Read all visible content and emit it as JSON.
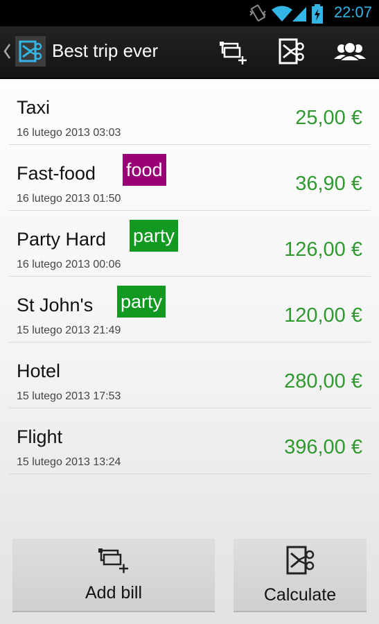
{
  "status_bar": {
    "time": "22:07"
  },
  "action_bar": {
    "title": "Best trip ever",
    "actions": [
      "add-bill-icon",
      "calculate-icon",
      "people-icon"
    ]
  },
  "bills": [
    {
      "name": "Taxi",
      "date": "16 lutego 2013 03:03",
      "amount": "25,00 €",
      "tag": null
    },
    {
      "name": "Fast-food",
      "date": "16 lutego 2013 01:50",
      "amount": "36,90 €",
      "tag": {
        "label": "food",
        "color": "#990077"
      }
    },
    {
      "name": "Party Hard",
      "date": "16 lutego 2013 00:06",
      "amount": "126,00 €",
      "tag": {
        "label": "party",
        "color": "#119922"
      }
    },
    {
      "name": "St John's",
      "date": "15 lutego 2013 21:49",
      "amount": "120,00 €",
      "tag": {
        "label": "party",
        "color": "#119922"
      }
    },
    {
      "name": "Hotel",
      "date": "15 lutego 2013 17:53",
      "amount": "280,00 €",
      "tag": null
    },
    {
      "name": "Flight",
      "date": "15 lutego 2013 13:24",
      "amount": "396,00 €",
      "tag": null
    }
  ],
  "buttons": {
    "add_bill": "Add bill",
    "calculate": "Calculate"
  },
  "colors": {
    "amount": "#2e9a2e",
    "accent": "#33b5e5"
  }
}
